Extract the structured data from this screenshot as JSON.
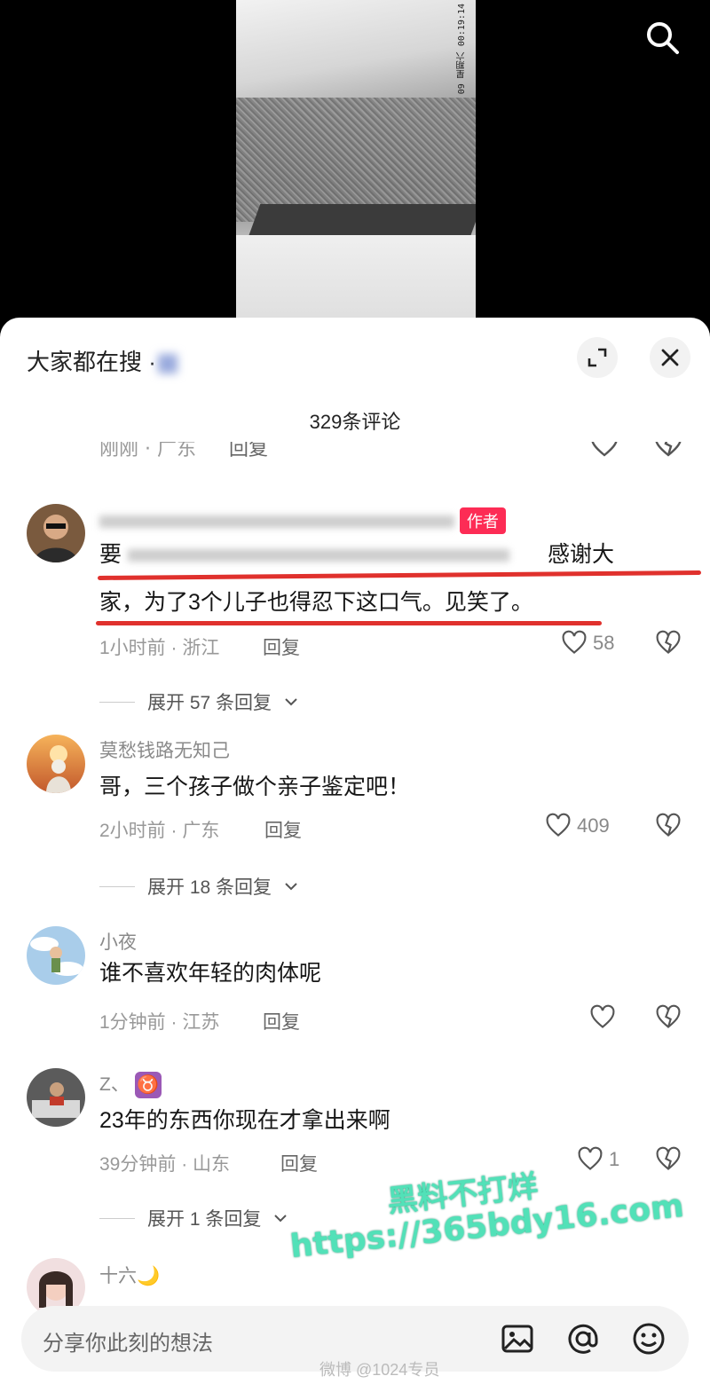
{
  "video": {
    "timestamp": "09 星期六 00:19:14"
  },
  "sheet": {
    "hot_search_prefix": "大家都在搜 ·",
    "comment_count": "329条评论"
  },
  "partial_comment": {
    "meta": "刚刚 · 广东",
    "reply_label": "回复"
  },
  "comments": [
    {
      "author_badge": "作者",
      "text_line1_tail": "感谢大",
      "text_line2": "家，为了3个儿子也得忍下这口气。见笑了。",
      "text_line1_head": "要",
      "meta": "1小时前 · 浙江",
      "reply_label": "回复",
      "likes": "58",
      "expand_label": "展开 57 条回复"
    },
    {
      "author": "莫愁钱路无知己",
      "text": "哥，三个孩子做个亲子鉴定吧！",
      "meta": "2小时前 · 广东",
      "reply_label": "回复",
      "likes": "409",
      "expand_label": "展开 18 条回复"
    },
    {
      "author": "小夜",
      "text": "谁不喜欢年轻的肉体呢",
      "meta": "1分钟前 · 江苏",
      "reply_label": "回复",
      "likes": ""
    },
    {
      "author": "Z、",
      "author_emoji": "♉",
      "text": "23年的东西你现在才拿出来啊",
      "meta": "39分钟前 · 山东",
      "reply_label": "回复",
      "likes": "1",
      "expand_label": "展开 1 条回复"
    },
    {
      "author": "十六🌙"
    }
  ],
  "input_bar": {
    "placeholder": "分享你此刻的想法"
  },
  "watermarks": {
    "line1": "黑料不打烊",
    "line2": "https://365bdy16.com",
    "weibo": "微博 @1024专员"
  },
  "colors": {
    "accent_red": "#e0312d",
    "author_badge": "#fd2c55",
    "watermark": "#52e1b8"
  }
}
